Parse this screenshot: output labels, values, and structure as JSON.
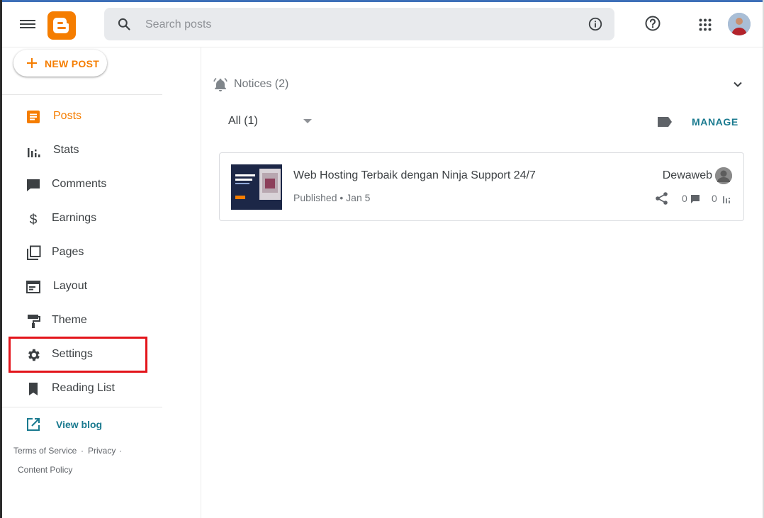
{
  "header": {
    "search_placeholder": "Search posts",
    "icons": [
      "menu-icon",
      "blogger-logo",
      "search-icon",
      "info-icon",
      "help-icon",
      "apps-icon",
      "avatar"
    ]
  },
  "sidebar": {
    "new_post_label": "NEW POST",
    "items": [
      {
        "label": "Posts",
        "icon": "posts-icon",
        "active": true
      },
      {
        "label": "Stats",
        "icon": "stats-icon"
      },
      {
        "label": "Comments",
        "icon": "comments-icon"
      },
      {
        "label": "Earnings",
        "icon": "dollar-icon"
      },
      {
        "label": "Pages",
        "icon": "pages-icon"
      },
      {
        "label": "Layout",
        "icon": "layout-icon"
      },
      {
        "label": "Theme",
        "icon": "paint-roller-icon"
      },
      {
        "label": "Settings",
        "icon": "gear-icon",
        "highlighted": true
      },
      {
        "label": "Reading List",
        "icon": "bookmark-icon"
      }
    ],
    "view_blog_label": "View blog",
    "footer": {
      "terms": "Terms of Service",
      "privacy": "Privacy",
      "content_policy": "Content Policy",
      "separator": "·"
    }
  },
  "main": {
    "notices_label": "Notices (2)",
    "filter_label": "All (1)",
    "manage_label": "MANAGE",
    "posts": [
      {
        "title": "Web Hosting Terbaik dengan Ninja Support 24/7",
        "status": "Published • Jan 5",
        "author": "Dewaweb",
        "comments": "0",
        "views": "0"
      }
    ]
  },
  "colors": {
    "accent": "#f57d00",
    "link": "#1a7a8f",
    "highlight": "#e3141b",
    "search_bg": "#e8eaed"
  }
}
